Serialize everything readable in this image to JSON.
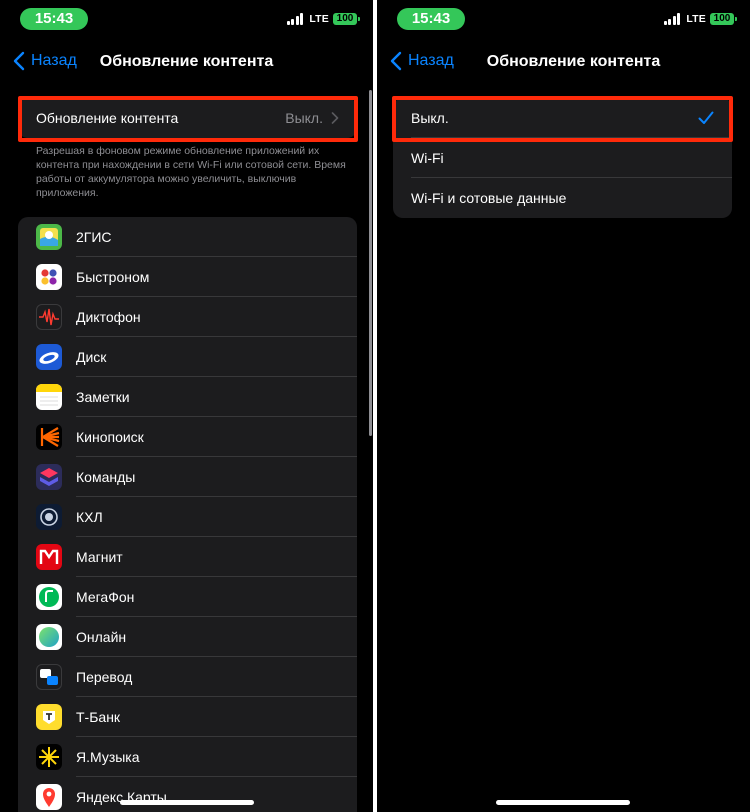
{
  "status": {
    "time": "15:43",
    "network": "LTE",
    "battery": "100"
  },
  "colors": {
    "accent": "#0a84ff",
    "time_pill": "#34c759",
    "highlight": "#ff2a0a"
  },
  "left": {
    "back_label": "Назад",
    "title": "Обновление контента",
    "setting_label": "Обновление контента",
    "setting_value": "Выкл.",
    "footnote": "Разрешая в фоновом режиме обновление приложений их контента при нахождении в сети Wi-Fi или сотовой сети. Время работы от аккумулятора можно увеличить, выключив приложения.",
    "apps": [
      {
        "label": "2ГИС",
        "icon": "map-icon"
      },
      {
        "label": "Быстроном",
        "icon": "dots-icon"
      },
      {
        "label": "Диктофон",
        "icon": "waveform-icon"
      },
      {
        "label": "Диск",
        "icon": "disk-icon"
      },
      {
        "label": "Заметки",
        "icon": "notes-icon"
      },
      {
        "label": "Кинопоиск",
        "icon": "kinopoisk-icon"
      },
      {
        "label": "Команды",
        "icon": "shortcuts-icon"
      },
      {
        "label": "КХЛ",
        "icon": "khl-icon"
      },
      {
        "label": "Магнит",
        "icon": "magnit-icon"
      },
      {
        "label": "МегаФон",
        "icon": "megafon-icon"
      },
      {
        "label": "Онлайн",
        "icon": "online-icon"
      },
      {
        "label": "Перевод",
        "icon": "translate-icon"
      },
      {
        "label": "Т-Банк",
        "icon": "tbank-icon"
      },
      {
        "label": "Я.Музыка",
        "icon": "music-icon"
      },
      {
        "label": "Яндекс Карты",
        "icon": "pin-icon"
      }
    ]
  },
  "right": {
    "back_label": "Назад",
    "title": "Обновление контента",
    "options": [
      {
        "label": "Выкл.",
        "selected": true
      },
      {
        "label": "Wi-Fi",
        "selected": false
      },
      {
        "label": "Wi-Fi и сотовые данные",
        "selected": false
      }
    ]
  }
}
